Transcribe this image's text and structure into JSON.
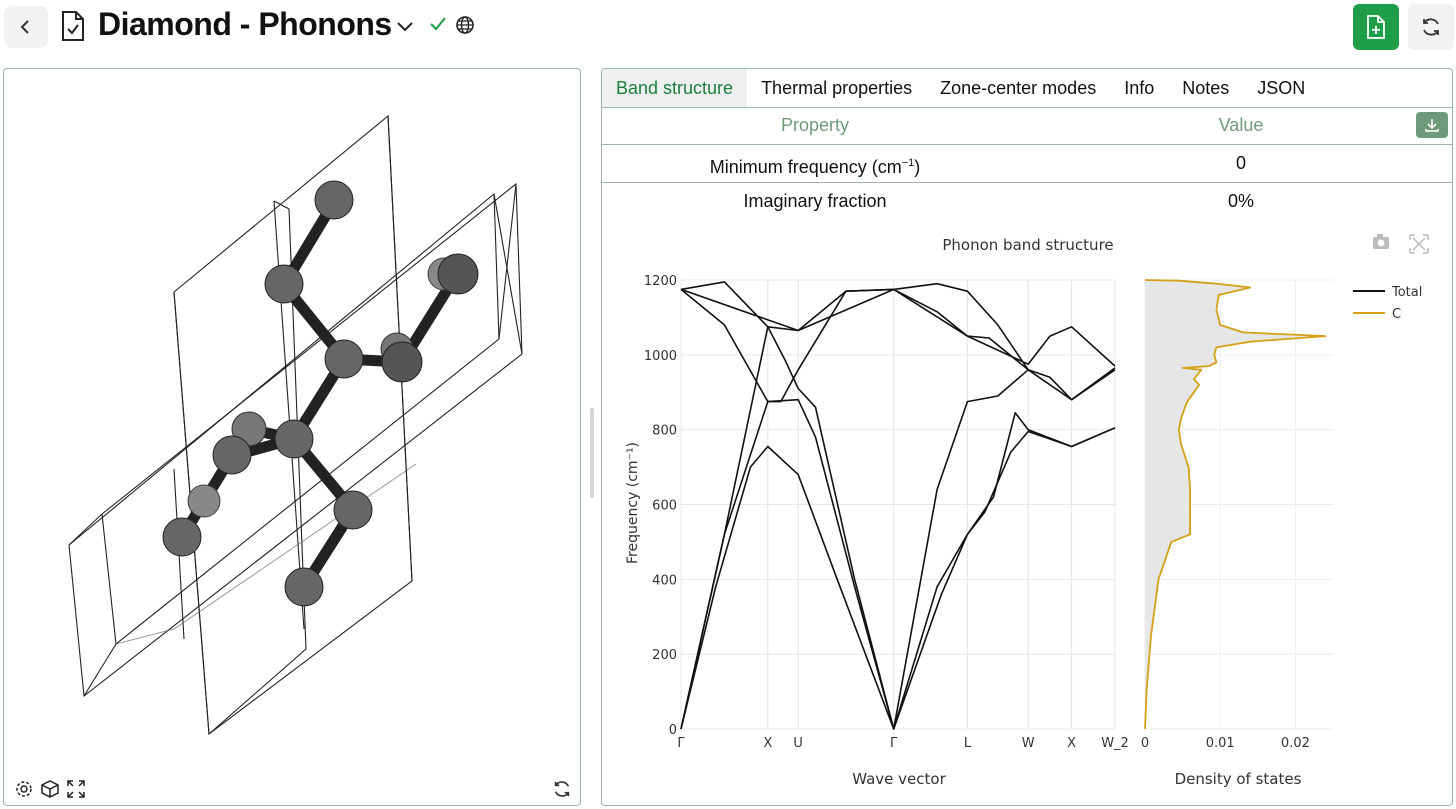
{
  "header": {
    "title": "Diamond - Phonons"
  },
  "tabs": [
    "Band structure",
    "Thermal properties",
    "Zone-center modes",
    "Info",
    "Notes",
    "JSON"
  ],
  "table": {
    "header_property": "Property",
    "header_value": "Value",
    "rows": [
      {
        "property_main": "Minimum frequency (cm",
        "property_sup": "−1",
        "property_end": ")",
        "value": "0"
      },
      {
        "property": "Imaginary fraction",
        "value": "0%"
      }
    ]
  },
  "colors": {
    "accent": "#1f9e4a",
    "total": "#111111",
    "carbon": "#d4a017"
  },
  "chart_data": [
    {
      "type": "line",
      "title": "Phonon band structure",
      "xlabel": "Wave vector",
      "ylabel": "Frequency (cm⁻¹)",
      "ylim": [
        0,
        1200
      ],
      "yticks": [
        0,
        200,
        400,
        600,
        800,
        1000,
        1200
      ],
      "x_tick_labels": [
        "Γ",
        "X",
        "U",
        "Γ",
        "L",
        "W",
        "X",
        "W_2"
      ],
      "x_tick_positions": [
        0,
        1.0,
        1.35,
        2.45,
        3.3,
        4.0,
        4.5,
        5.0
      ],
      "series": [
        {
          "values": [
            [
              0,
              1175
            ],
            [
              0.5,
              1195
            ],
            [
              1.0,
              1075
            ],
            [
              1.35,
              1065
            ],
            [
              1.9,
              1170
            ],
            [
              2.45,
              1175
            ],
            [
              2.95,
              1190
            ],
            [
              3.3,
              1170
            ],
            [
              3.65,
              1080
            ],
            [
              4.0,
              960
            ]
          ]
        },
        {
          "values": [
            [
              0,
              1175
            ],
            [
              0.5,
              1080
            ],
            [
              1.0,
              875
            ],
            [
              1.15,
              875
            ],
            [
              1.35,
              960
            ],
            [
              1.9,
              1170
            ],
            [
              2.45,
              1175
            ],
            [
              2.95,
              1115
            ],
            [
              3.3,
              1050
            ],
            [
              4.0,
              975
            ],
            [
              4.25,
              1050
            ],
            [
              4.5,
              1075
            ],
            [
              5.0,
              970
            ]
          ]
        },
        {
          "values": [
            [
              0,
              1175
            ],
            [
              1.35,
              1065
            ],
            [
              2.45,
              1175
            ],
            [
              3.3,
              1050
            ],
            [
              3.55,
              1045
            ],
            [
              4.0,
              960
            ],
            [
              4.5,
              880
            ],
            [
              5.0,
              965
            ]
          ]
        },
        {
          "values": [
            [
              0,
              0
            ],
            [
              0.5,
              520
            ],
            [
              1.0,
              875
            ],
            [
              1.35,
              880
            ],
            [
              1.55,
              780
            ],
            [
              2.0,
              380
            ],
            [
              2.45,
              0
            ],
            [
              2.95,
              640
            ],
            [
              3.3,
              875
            ],
            [
              3.65,
              890
            ],
            [
              4.0,
              960
            ],
            [
              4.25,
              940
            ],
            [
              4.5,
              880
            ],
            [
              5.0,
              960
            ]
          ]
        },
        {
          "values": [
            [
              0,
              0
            ],
            [
              0.5,
              520
            ],
            [
              1.0,
              1075
            ],
            [
              1.2,
              985
            ],
            [
              1.35,
              910
            ],
            [
              1.55,
              860
            ],
            [
              2.0,
              400
            ],
            [
              2.45,
              0
            ],
            [
              2.95,
              380
            ],
            [
              3.3,
              520
            ],
            [
              3.6,
              620
            ],
            [
              3.85,
              845
            ],
            [
              4.0,
              800
            ],
            [
              4.5,
              755
            ],
            [
              5.0,
              805
            ]
          ]
        },
        {
          "values": [
            [
              0,
              0
            ],
            [
              0.4,
              380
            ],
            [
              0.8,
              700
            ],
            [
              1.0,
              755
            ],
            [
              1.35,
              680
            ],
            [
              1.8,
              400
            ],
            [
              2.45,
              0
            ],
            [
              3.0,
              360
            ],
            [
              3.3,
              520
            ],
            [
              3.5,
              580
            ],
            [
              3.8,
              740
            ],
            [
              4.0,
              795
            ],
            [
              4.5,
              755
            ],
            [
              5.0,
              805
            ]
          ]
        }
      ]
    },
    {
      "type": "line",
      "xlabel": "Density of states",
      "xlim": [
        0,
        0.025
      ],
      "xticks": [
        0,
        0.01,
        0.02
      ],
      "x_tick_labels": [
        "0",
        "0.01",
        "0.02"
      ],
      "series": [
        {
          "name": "Total",
          "color": "#111111",
          "values": []
        },
        {
          "name": "C",
          "color": "#d4a017",
          "points": [
            [
              0,
              0
            ],
            [
              0.0002,
              100
            ],
            [
              0.0008,
              250
            ],
            [
              0.0018,
              400
            ],
            [
              0.0035,
              500
            ],
            [
              0.006,
              520
            ],
            [
              0.006,
              560
            ],
            [
              0.006,
              640
            ],
            [
              0.0058,
              700
            ],
            [
              0.0048,
              760
            ],
            [
              0.0045,
              800
            ],
            [
              0.0048,
              830
            ],
            [
              0.0055,
              870
            ],
            [
              0.0058,
              880
            ],
            [
              0.0065,
              900
            ],
            [
              0.0072,
              920
            ],
            [
              0.0065,
              935
            ],
            [
              0.0075,
              960
            ],
            [
              0.005,
              965
            ],
            [
              0.0085,
              970
            ],
            [
              0.0095,
              980
            ],
            [
              0.0092,
              1000
            ],
            [
              0.0095,
              1020
            ],
            [
              0.014,
              1035
            ],
            [
              0.024,
              1050
            ],
            [
              0.013,
              1060
            ],
            [
              0.01,
              1080
            ],
            [
              0.0095,
              1120
            ],
            [
              0.0098,
              1160
            ],
            [
              0.014,
              1180
            ],
            [
              0.0095,
              1190
            ],
            [
              0.0045,
              1198
            ],
            [
              0.0,
              1200
            ]
          ]
        }
      ]
    }
  ]
}
